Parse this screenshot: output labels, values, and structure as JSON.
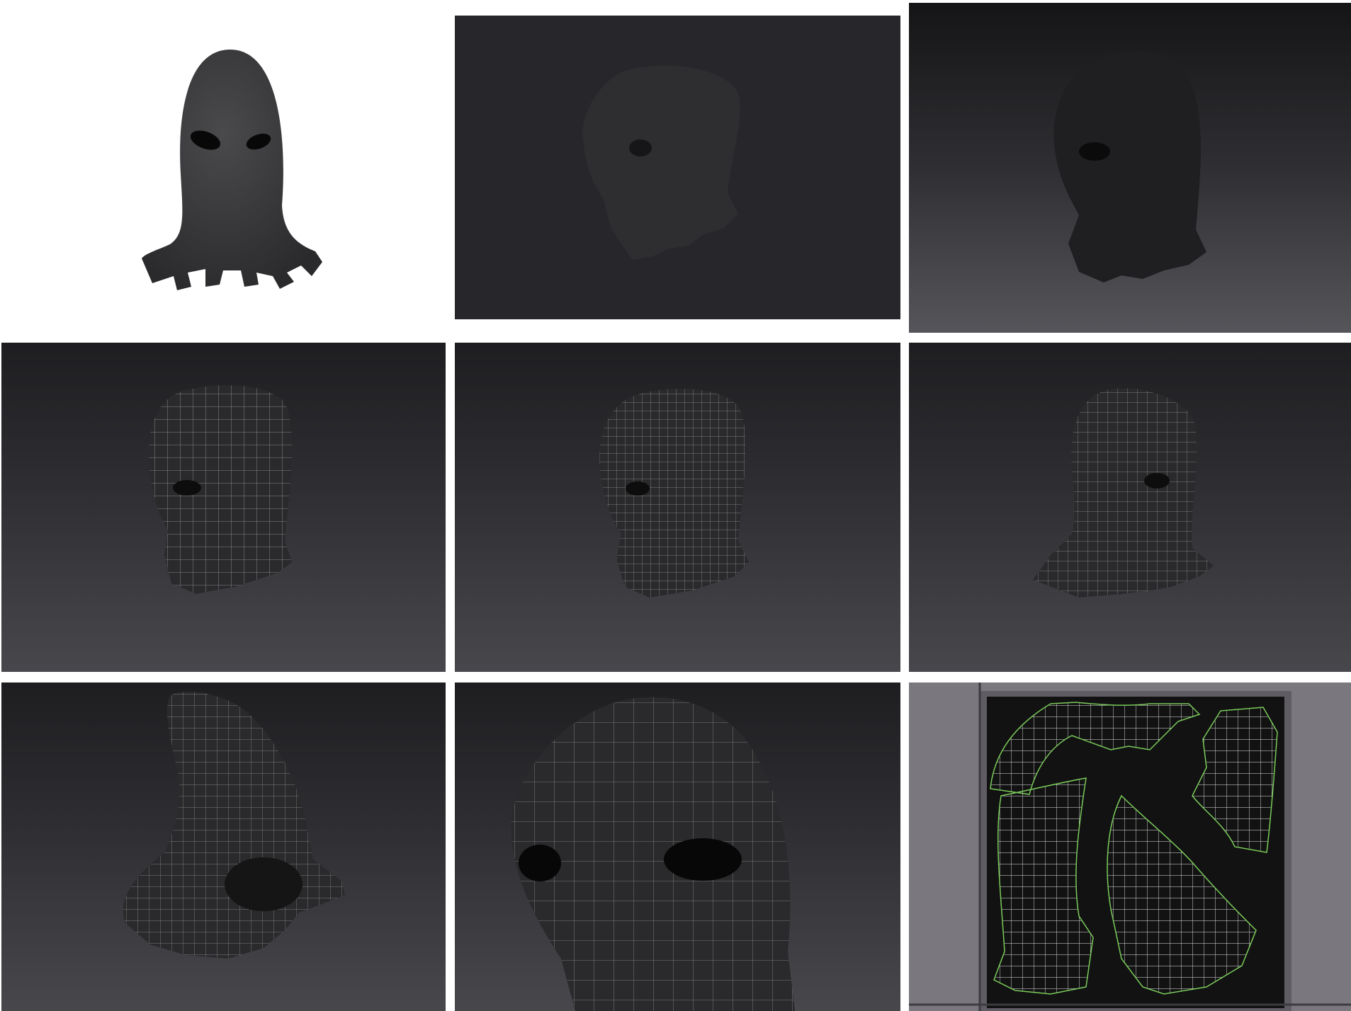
{
  "panels": [
    {
      "name": "white-render-front",
      "content": "hood-front-render"
    },
    {
      "name": "dark-render-side",
      "content": "hood-side-render"
    },
    {
      "name": "viewport-render-side",
      "content": "hood-side-render-gradient"
    },
    {
      "name": "wireframe-low-side",
      "content": "hood-wireframe"
    },
    {
      "name": "wireframe-mid-side",
      "content": "hood-wireframe-dense"
    },
    {
      "name": "wireframe-back-side",
      "content": "hood-wireframe-back"
    },
    {
      "name": "wireframe-below",
      "content": "hood-wireframe-bottom"
    },
    {
      "name": "wireframe-closeup-eye",
      "content": "hood-wireframe-closeup"
    },
    {
      "name": "uv-layout",
      "content": "uv-islands"
    }
  ],
  "colors": {
    "hood": "#2a2a2c",
    "wire": "#d9d9d9",
    "uv_outline": "#7acb5a",
    "uv_bg": "#121212",
    "uv_frame": "#5f5d63"
  }
}
